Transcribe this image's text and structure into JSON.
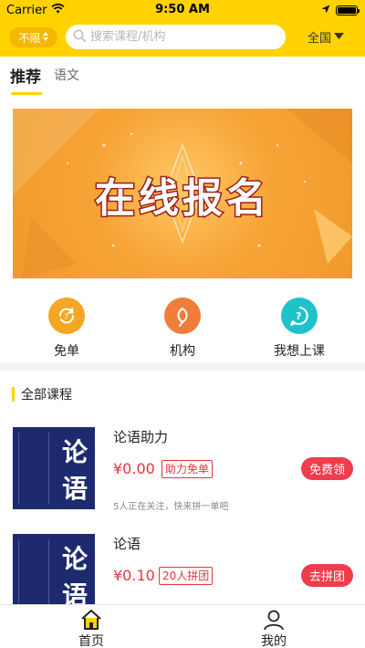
{
  "status_bar": {
    "carrier": "Carrier",
    "time": "9:50 AM",
    "battery_level": 1.0
  },
  "header": {
    "filter_label": "不限",
    "search_placeholder": "搜索课程/机构",
    "region_label": "全国",
    "accent_color": "#FFD200"
  },
  "tabs": [
    {
      "label": "推荐",
      "active": true
    },
    {
      "label": "语文",
      "active": false
    }
  ],
  "banner": {
    "title": "在线报名"
  },
  "quick_links": [
    {
      "label": "免单",
      "icon": "refresh-coupon-icon",
      "color": "#F5A623"
    },
    {
      "label": "机构",
      "icon": "leaf-icon",
      "color": "#F07D3A"
    },
    {
      "label": "我想上课",
      "icon": "question-bubble-icon",
      "color": "#1EC3C9"
    }
  ],
  "courses_section": {
    "title": "全部课程",
    "items": [
      {
        "name": "论语助力",
        "cover_text": [
          "论",
          "语"
        ],
        "price": "¥0.00",
        "tag": "助力免单",
        "button": "免费领",
        "meta": "5人正在关注，快来拼一单吧"
      },
      {
        "name": "论语",
        "cover_text": [
          "论",
          "语"
        ],
        "price": "¥0.10",
        "tag": "20人拼团",
        "button": "去拼团",
        "meta": ""
      }
    ]
  },
  "bottom_nav": [
    {
      "label": "首页",
      "icon": "home-icon",
      "active": true
    },
    {
      "label": "我的",
      "icon": "profile-icon",
      "active": false
    }
  ]
}
